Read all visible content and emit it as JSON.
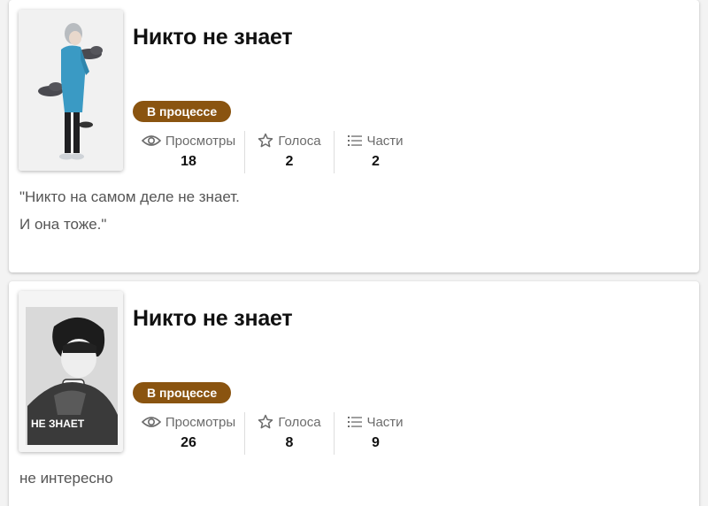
{
  "stories": [
    {
      "title": "Никто не знает",
      "status": "В процессе",
      "stats": {
        "views_label": "Просмотры",
        "views": "18",
        "votes_label": "Голоса",
        "votes": "2",
        "parts_label": "Части",
        "parts": "2"
      },
      "description": [
        "\"Никто на самом деле не знает.",
        "И она тоже.\""
      ]
    },
    {
      "title": "Никто не знает",
      "status": "В процессе",
      "cover_text": "НЕ ЗНАЕТ",
      "stats": {
        "views_label": "Просмотры",
        "views": "26",
        "votes_label": "Голоса",
        "votes": "8",
        "parts_label": "Части",
        "parts": "9"
      },
      "description": [
        "не интересно"
      ]
    }
  ],
  "colors": {
    "status_bg": "#8a5410",
    "card_bg": "#ffffff",
    "muted_text": "#6b6b6b"
  },
  "icons": [
    "eye-icon",
    "star-icon",
    "list-icon"
  ]
}
